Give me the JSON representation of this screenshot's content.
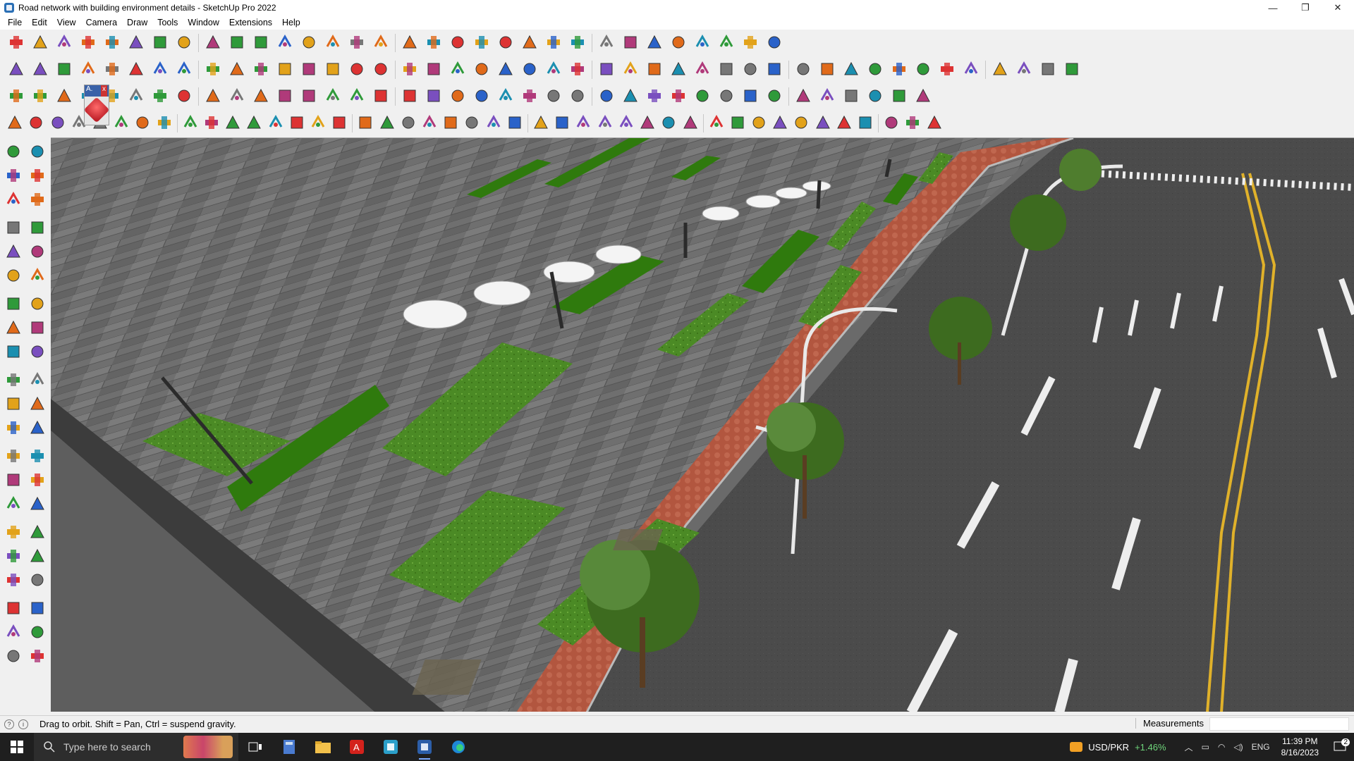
{
  "window": {
    "title": "Road network with building environment details - SketchUp Pro 2022",
    "buttons": [
      "—",
      "❐",
      "✕"
    ]
  },
  "menu": [
    "File",
    "Edit",
    "View",
    "Camera",
    "Draw",
    "Tools",
    "Window",
    "Extensions",
    "Help"
  ],
  "toolbar_rows": [
    [
      "zoom-icon",
      "select-icon",
      "eraser-icon",
      "pencil-icon",
      "lasso-icon",
      "paint-bucket-icon",
      "push-pull-icon",
      "follow-me-icon",
      "move-icon",
      "rotate-icon",
      "scale-icon",
      "tape-measure-icon",
      "text-icon",
      "paint-icon",
      "orbit-icon",
      "pan-icon",
      "zoom-window-icon",
      "zoom-extents-icon",
      "section-plane-icon",
      "section-display-icon",
      "section-cut-icon",
      "layers-icon",
      "user-profile-icon",
      "camera-icon",
      "walk-icon",
      "arrow-icon",
      "stairs-icon",
      "dimension-icon",
      "protractor-icon",
      "undo-icon",
      "redo-icon",
      "model-info-icon"
    ],
    [
      "components-icon",
      "materials-icon",
      "styles-icon",
      "iso-view-icon",
      "top-view-icon",
      "front-view-icon",
      "right-view-icon",
      "back-view-icon",
      "left-view-icon",
      "bottom-view-icon",
      "sandbox-icon",
      "section-icon",
      "solid-tools-icon",
      "x-ray-icon",
      "back-edges-icon",
      "wireframe-icon",
      "hidden-line-icon",
      "shaded-icon",
      "textured-icon",
      "monochrome-icon",
      "house-icon",
      "house-outline-icon",
      "warehouse-icon",
      "extension-icon",
      "sign-icon",
      "pencil-tool-icon",
      "shape-circle-icon",
      "shape-polygon-icon",
      "shape-ellipse-icon",
      "shape-parallelogram-icon",
      "shape-arc-icon",
      "shape-rotate-icon",
      "dynamic-icon",
      "curve-icon",
      "spiral-icon",
      "line-tool-icon",
      "eraser-pink-icon",
      "terrain-icon",
      "grid-icon",
      "flatten-icon",
      "drape-icon",
      "stamp-icon",
      "smoove-icon",
      "add-detail-icon"
    ],
    [
      "blue-plane-icon",
      "blue-tile-icon",
      "yellow-tile-icon",
      "ruby-console-icon",
      "red-diamond-icon",
      "gray-tile-icon",
      "loop-icon",
      "red-square-icon",
      "stack-icon",
      "panel-icon",
      "log-icon",
      "chain-icon",
      "bend-icon",
      "spline-icon",
      "cross-icon",
      "green-cross-icon",
      "blue-cross-icon",
      "cone-icon",
      "dome-icon",
      "triangle-icon",
      "ring-icon",
      "knot-icon",
      "orbit-ring-icon",
      "move-star-icon",
      "box-icon",
      "undo-red-icon",
      "tree-icon",
      "cube-red-icon",
      "cube-pink-icon",
      "gem-icon",
      "bricks-icon",
      "window-icon",
      "grid-yellow-icon",
      "waffle-icon",
      "waffle2-icon",
      "scatter-icon",
      "curve-dots-icon",
      "puzzle-icon"
    ],
    [
      "sketch-icon",
      "curve-red-icon",
      "car-icon",
      "ruby-icon",
      "select-arrow-icon",
      "polygon-icon",
      "tile-flat-icon",
      "lasso2-icon",
      "hook-icon",
      "cube-wire-icon",
      "sphere-wire-icon",
      "arrow-draw-icon",
      "angle-icon",
      "angle2-icon",
      "red-line-icon",
      "shoe-icon",
      "building-icon",
      "tent-icon",
      "columns-icon",
      "vertebra-icon",
      "hand-icon",
      "leaf-icon",
      "star-arrow-icon",
      "ladder-icon",
      "feather-icon",
      "wind-icon",
      "arrows-icon",
      "lines-icon",
      "roof-icon",
      "stairs2-icon",
      "fence-icon",
      "bench-icon",
      "hatch-icon",
      "hatch2-icon",
      "hatch3-icon",
      "hatch4-icon",
      "vent-icon",
      "gear-icon",
      "ornament-icon",
      "brush-icon",
      "slope-icon",
      "strands-icon",
      "rock-icon"
    ]
  ],
  "floating_panel": {
    "label": "A.",
    "close": "x"
  },
  "sidebar": [
    "select-icon",
    "orbit-tool-icon",
    "paint-bucket-icon",
    "eraser-icon",
    "component-icon",
    "tape-icon",
    "line-icon",
    "freehand-icon",
    "rectangle-icon",
    "rotated-rect-icon",
    "circle-icon",
    "polygon-icon",
    "arc-icon",
    "pie-icon",
    "two-point-arc-icon",
    "three-point-arc-icon",
    "move-icon",
    "push-pull-icon",
    "rotate-icon",
    "follow-me-icon",
    "scale-icon",
    "offset-icon",
    "tape-measure-icon",
    "dimension-icon",
    "protractor-icon",
    "text-icon",
    "axes-icon",
    "3d-text-icon",
    "orbit-icon",
    "pan-icon",
    "zoom-icon",
    "zoom-window-icon",
    "zoom-extents-icon",
    "zoom-prev-icon",
    "position-camera-icon",
    "look-around-icon",
    "walk-icon",
    "section-plane-icon",
    "section-display-icon",
    "section-fill-icon",
    "layers-icon",
    "outliner-icon"
  ],
  "status": {
    "hint": "Drag to orbit. Shift = Pan, Ctrl = suspend gravity.",
    "measurements_label": "Measurements"
  },
  "taskbar": {
    "search_placeholder": "Type here to search",
    "pins": [
      "task-view-icon",
      "calculator-icon",
      "file-explorer-icon",
      "acrobat-icon",
      "word-icon",
      "sketchup-icon",
      "edge-icon"
    ],
    "fx_label": "USD/PKR",
    "fx_change": "+1.46%",
    "lang": "ENG",
    "time": "11:39 PM",
    "date": "8/16/2023",
    "notifications": "2"
  },
  "colors": {
    "chrome": "#f0f0f0",
    "taskbar": "#1f1f1f",
    "asphalt": "#4a4a4a",
    "paving": "#727272",
    "grass": "#3f7d1c",
    "brick": "#b2563f",
    "lane_yellow": "#e0b12a"
  }
}
